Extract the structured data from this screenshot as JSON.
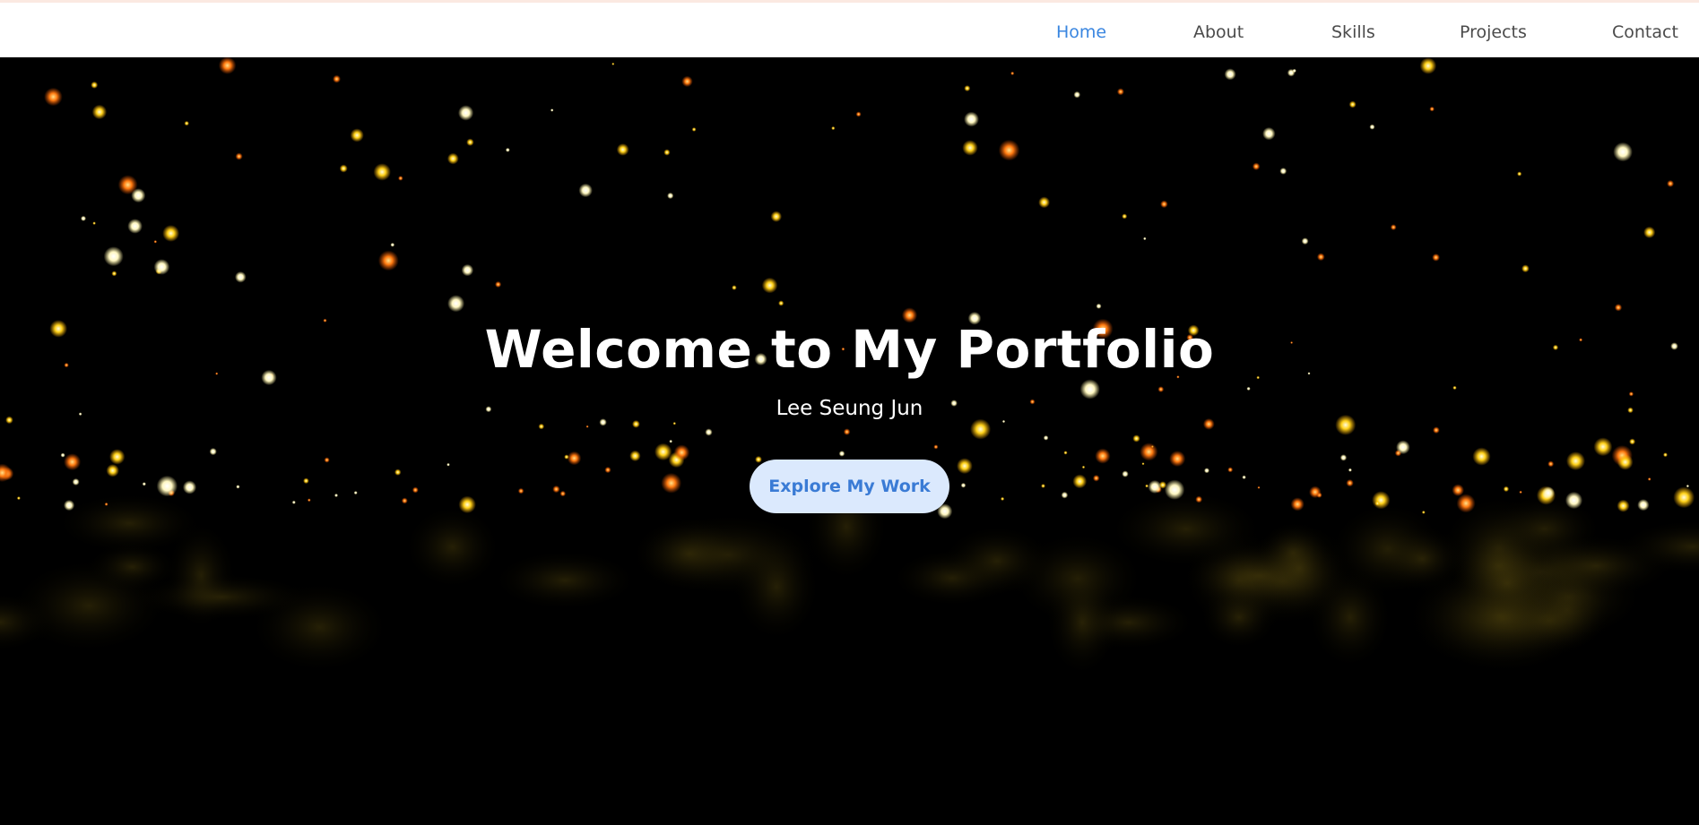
{
  "nav": {
    "items": [
      {
        "label": "Home",
        "active": true
      },
      {
        "label": "About",
        "active": false
      },
      {
        "label": "Skills",
        "active": false
      },
      {
        "label": "Projects",
        "active": false
      },
      {
        "label": "Contact",
        "active": false
      }
    ]
  },
  "hero": {
    "title": "Welcome to My Portfolio",
    "subtitle": "Lee Seung Jun",
    "cta_label": "Explore My Work"
  },
  "colors": {
    "accent": "#3a86e0",
    "nav_text": "#4b4b4b",
    "button_bg": "#dbe9fd",
    "background": "#000000"
  }
}
